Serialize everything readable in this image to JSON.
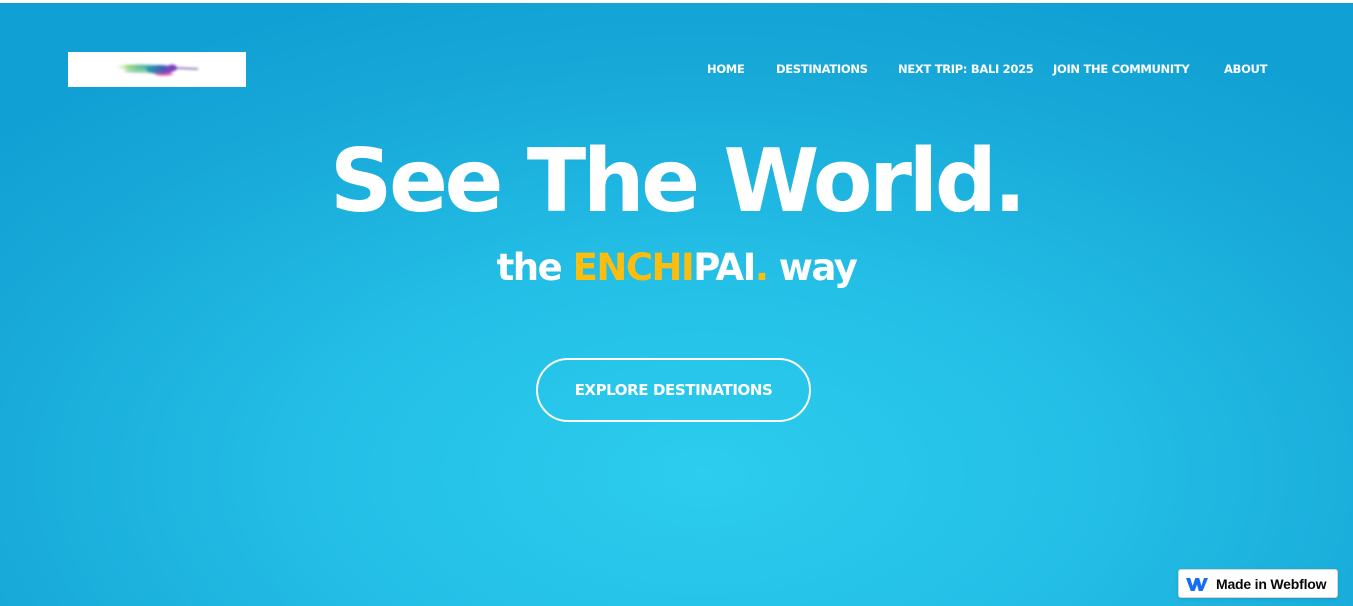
{
  "header": {
    "logo_icon": "hummingbird-logo",
    "nav": [
      {
        "label": "HOME"
      },
      {
        "label": "DESTINATIONS"
      },
      {
        "label": "NEXT TRIP: BALI 2025"
      },
      {
        "label": "JOIN THE COMMUNITY"
      },
      {
        "label": "ABOUT"
      }
    ]
  },
  "hero": {
    "headline": "See The World.",
    "tagline": {
      "prefix": "the ",
      "brand_highlight": "ENCHI",
      "brand_rest": "PAI",
      "brand_dot": ".",
      "suffix": " way"
    },
    "cta_label": "EXPLORE DESTINATIONS"
  },
  "badge": {
    "icon": "webflow-icon",
    "label": "Made in Webflow"
  },
  "colors": {
    "background": "#1fb6e3",
    "text": "#ffffff",
    "accent": "#fbbd0f",
    "webflow_blue": "#146ef5"
  }
}
